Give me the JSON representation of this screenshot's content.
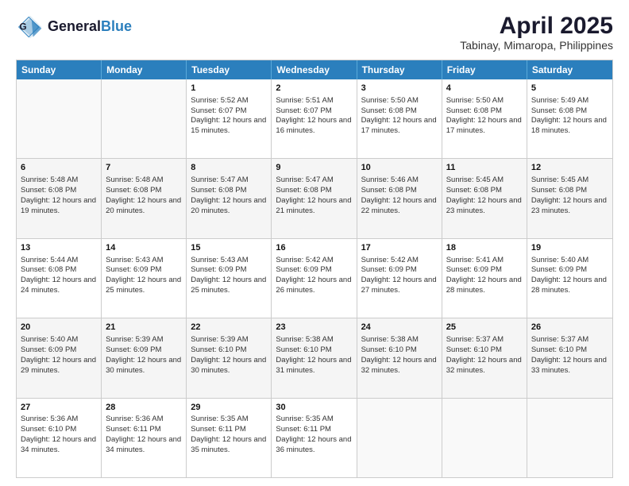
{
  "header": {
    "logo_line1": "General",
    "logo_line2": "Blue",
    "title": "April 2025",
    "subtitle": "Tabinay, Mimaropa, Philippines"
  },
  "days": [
    "Sunday",
    "Monday",
    "Tuesday",
    "Wednesday",
    "Thursday",
    "Friday",
    "Saturday"
  ],
  "rows": [
    [
      {
        "day": "",
        "empty": true
      },
      {
        "day": "",
        "empty": true
      },
      {
        "day": "1",
        "sunrise": "Sunrise: 5:52 AM",
        "sunset": "Sunset: 6:07 PM",
        "daylight": "Daylight: 12 hours and 15 minutes."
      },
      {
        "day": "2",
        "sunrise": "Sunrise: 5:51 AM",
        "sunset": "Sunset: 6:07 PM",
        "daylight": "Daylight: 12 hours and 16 minutes."
      },
      {
        "day": "3",
        "sunrise": "Sunrise: 5:50 AM",
        "sunset": "Sunset: 6:08 PM",
        "daylight": "Daylight: 12 hours and 17 minutes."
      },
      {
        "day": "4",
        "sunrise": "Sunrise: 5:50 AM",
        "sunset": "Sunset: 6:08 PM",
        "daylight": "Daylight: 12 hours and 17 minutes."
      },
      {
        "day": "5",
        "sunrise": "Sunrise: 5:49 AM",
        "sunset": "Sunset: 6:08 PM",
        "daylight": "Daylight: 12 hours and 18 minutes."
      }
    ],
    [
      {
        "day": "6",
        "sunrise": "Sunrise: 5:48 AM",
        "sunset": "Sunset: 6:08 PM",
        "daylight": "Daylight: 12 hours and 19 minutes."
      },
      {
        "day": "7",
        "sunrise": "Sunrise: 5:48 AM",
        "sunset": "Sunset: 6:08 PM",
        "daylight": "Daylight: 12 hours and 20 minutes."
      },
      {
        "day": "8",
        "sunrise": "Sunrise: 5:47 AM",
        "sunset": "Sunset: 6:08 PM",
        "daylight": "Daylight: 12 hours and 20 minutes."
      },
      {
        "day": "9",
        "sunrise": "Sunrise: 5:47 AM",
        "sunset": "Sunset: 6:08 PM",
        "daylight": "Daylight: 12 hours and 21 minutes."
      },
      {
        "day": "10",
        "sunrise": "Sunrise: 5:46 AM",
        "sunset": "Sunset: 6:08 PM",
        "daylight": "Daylight: 12 hours and 22 minutes."
      },
      {
        "day": "11",
        "sunrise": "Sunrise: 5:45 AM",
        "sunset": "Sunset: 6:08 PM",
        "daylight": "Daylight: 12 hours and 23 minutes."
      },
      {
        "day": "12",
        "sunrise": "Sunrise: 5:45 AM",
        "sunset": "Sunset: 6:08 PM",
        "daylight": "Daylight: 12 hours and 23 minutes."
      }
    ],
    [
      {
        "day": "13",
        "sunrise": "Sunrise: 5:44 AM",
        "sunset": "Sunset: 6:08 PM",
        "daylight": "Daylight: 12 hours and 24 minutes."
      },
      {
        "day": "14",
        "sunrise": "Sunrise: 5:43 AM",
        "sunset": "Sunset: 6:09 PM",
        "daylight": "Daylight: 12 hours and 25 minutes."
      },
      {
        "day": "15",
        "sunrise": "Sunrise: 5:43 AM",
        "sunset": "Sunset: 6:09 PM",
        "daylight": "Daylight: 12 hours and 25 minutes."
      },
      {
        "day": "16",
        "sunrise": "Sunrise: 5:42 AM",
        "sunset": "Sunset: 6:09 PM",
        "daylight": "Daylight: 12 hours and 26 minutes."
      },
      {
        "day": "17",
        "sunrise": "Sunrise: 5:42 AM",
        "sunset": "Sunset: 6:09 PM",
        "daylight": "Daylight: 12 hours and 27 minutes."
      },
      {
        "day": "18",
        "sunrise": "Sunrise: 5:41 AM",
        "sunset": "Sunset: 6:09 PM",
        "daylight": "Daylight: 12 hours and 28 minutes."
      },
      {
        "day": "19",
        "sunrise": "Sunrise: 5:40 AM",
        "sunset": "Sunset: 6:09 PM",
        "daylight": "Daylight: 12 hours and 28 minutes."
      }
    ],
    [
      {
        "day": "20",
        "sunrise": "Sunrise: 5:40 AM",
        "sunset": "Sunset: 6:09 PM",
        "daylight": "Daylight: 12 hours and 29 minutes."
      },
      {
        "day": "21",
        "sunrise": "Sunrise: 5:39 AM",
        "sunset": "Sunset: 6:09 PM",
        "daylight": "Daylight: 12 hours and 30 minutes."
      },
      {
        "day": "22",
        "sunrise": "Sunrise: 5:39 AM",
        "sunset": "Sunset: 6:10 PM",
        "daylight": "Daylight: 12 hours and 30 minutes."
      },
      {
        "day": "23",
        "sunrise": "Sunrise: 5:38 AM",
        "sunset": "Sunset: 6:10 PM",
        "daylight": "Daylight: 12 hours and 31 minutes."
      },
      {
        "day": "24",
        "sunrise": "Sunrise: 5:38 AM",
        "sunset": "Sunset: 6:10 PM",
        "daylight": "Daylight: 12 hours and 32 minutes."
      },
      {
        "day": "25",
        "sunrise": "Sunrise: 5:37 AM",
        "sunset": "Sunset: 6:10 PM",
        "daylight": "Daylight: 12 hours and 32 minutes."
      },
      {
        "day": "26",
        "sunrise": "Sunrise: 5:37 AM",
        "sunset": "Sunset: 6:10 PM",
        "daylight": "Daylight: 12 hours and 33 minutes."
      }
    ],
    [
      {
        "day": "27",
        "sunrise": "Sunrise: 5:36 AM",
        "sunset": "Sunset: 6:10 PM",
        "daylight": "Daylight: 12 hours and 34 minutes."
      },
      {
        "day": "28",
        "sunrise": "Sunrise: 5:36 AM",
        "sunset": "Sunset: 6:11 PM",
        "daylight": "Daylight: 12 hours and 34 minutes."
      },
      {
        "day": "29",
        "sunrise": "Sunrise: 5:35 AM",
        "sunset": "Sunset: 6:11 PM",
        "daylight": "Daylight: 12 hours and 35 minutes."
      },
      {
        "day": "30",
        "sunrise": "Sunrise: 5:35 AM",
        "sunset": "Sunset: 6:11 PM",
        "daylight": "Daylight: 12 hours and 36 minutes."
      },
      {
        "day": "",
        "empty": true
      },
      {
        "day": "",
        "empty": true
      },
      {
        "day": "",
        "empty": true
      }
    ]
  ]
}
